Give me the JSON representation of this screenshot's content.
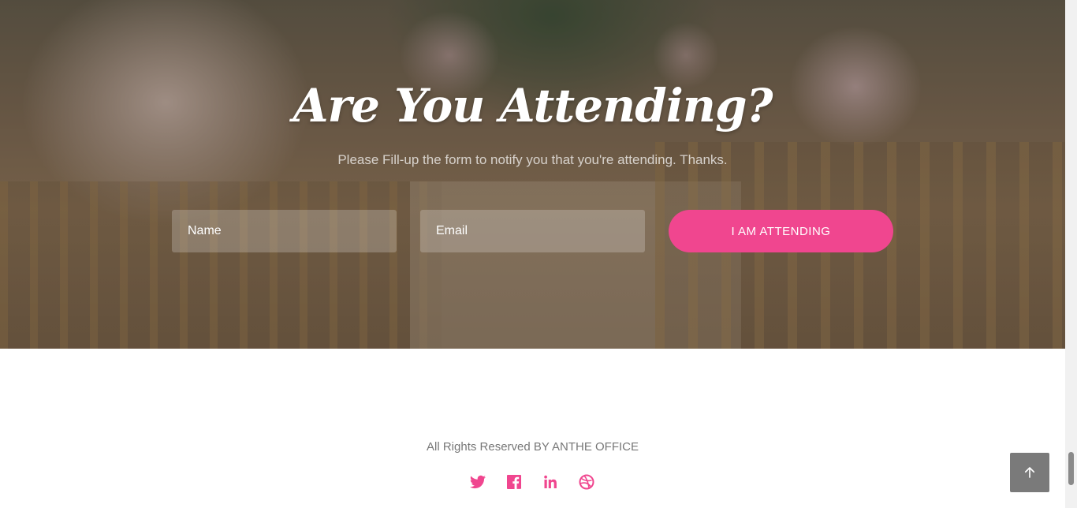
{
  "rsvp": {
    "title": "Are You Attending?",
    "subtitle": "Please Fill-up the form to notify you that you're attending. Thanks.",
    "name_placeholder": "Name",
    "email_placeholder": "Email",
    "submit_label": "I AM ATTENDING"
  },
  "footer": {
    "copyright": "All Rights Reserved BY ANTHE OFFICE",
    "social_icons": [
      "twitter-icon",
      "facebook-icon",
      "linkedin-icon",
      "dribbble-icon"
    ]
  },
  "colors": {
    "accent": "#f0468f",
    "back_to_top": "#7a7a7a"
  },
  "back_to_top": {
    "icon": "arrow-up-icon"
  }
}
